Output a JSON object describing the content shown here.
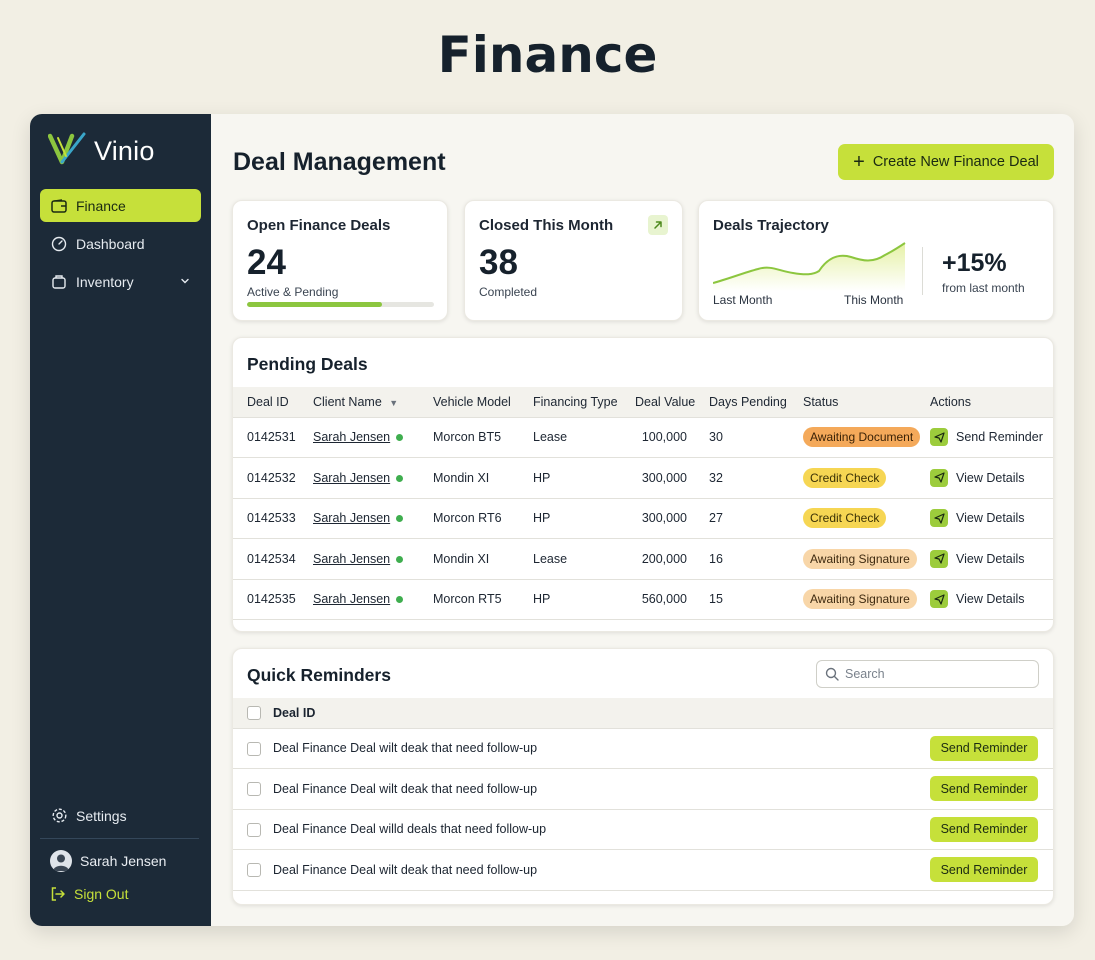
{
  "page": {
    "heading": "Finance"
  },
  "sidebar": {
    "brand": "Vinio",
    "nav": [
      {
        "label": "Finance",
        "icon": "wallet-icon",
        "active": true
      },
      {
        "label": "Dashboard",
        "icon": "gauge-icon"
      },
      {
        "label": "Inventory",
        "icon": "box-icon",
        "expandable": true
      }
    ],
    "settings_label": "Settings",
    "user_name": "Sarah Jensen",
    "signout_label": "Sign Out"
  },
  "header": {
    "title": "Deal Management",
    "cta_label": "Create New Finance Deal"
  },
  "stats": {
    "open": {
      "title": "Open Finance Deals",
      "value": "24",
      "sub": "Active & Pending",
      "progress": 0.72
    },
    "closed": {
      "title": "Closed This Month",
      "value": "38",
      "sub": "Completed"
    },
    "trajectory": {
      "title": "Deals Trajectory",
      "from_label": "Last Month",
      "to_label": "This Month",
      "change": "+15%",
      "change_sub": "from last month"
    }
  },
  "pending": {
    "title": "Pending Deals",
    "columns": [
      "Deal ID",
      "Client Name",
      "Vehicle Model",
      "Financing Type",
      "Deal Value",
      "Days Pending",
      "Status",
      "Actions"
    ],
    "rows": [
      {
        "id": "0142531",
        "client": "Sarah Jensen",
        "vehicle": "Morcon BT5",
        "type": "Lease",
        "value": "100,000",
        "days": "30",
        "status": "Awaiting Document",
        "status_color": "#f4a95a",
        "action": "Send Reminder"
      },
      {
        "id": "0142532",
        "client": "Sarah Jensen",
        "vehicle": "Mondin XI",
        "type": "HP",
        "value": "300,000",
        "days": "32",
        "status": "Credit Check",
        "status_color": "#f6d653",
        "action": "View Details"
      },
      {
        "id": "0142533",
        "client": "Sarah Jensen",
        "vehicle": "Morcon RT6",
        "type": "HP",
        "value": "300,000",
        "days": "27",
        "status": "Credit Check",
        "status_color": "#f6d653",
        "action": "View Details"
      },
      {
        "id": "0142534",
        "client": "Sarah Jensen",
        "vehicle": "Mondin XI",
        "type": "Lease",
        "value": "200,000",
        "days": "16",
        "status": "Awaiting Signature",
        "status_color": "#f8d6a8",
        "action": "View Details"
      },
      {
        "id": "0142535",
        "client": "Sarah Jensen",
        "vehicle": "Morcon RT5",
        "type": "HP",
        "value": "560,000",
        "days": "15",
        "status": "Awaiting Signature",
        "status_color": "#f8d6a8",
        "action": "View Details"
      }
    ]
  },
  "reminders": {
    "title": "Quick Reminders",
    "search_placeholder": "Search",
    "column": "Deal ID",
    "button_label": "Send Reminder",
    "items": [
      "Deal Finance Deal wilt deak that need follow-up",
      "Deal Finance Deal wilt deak that need follow-up",
      "Deal Finance Deal willd deals that need follow-up",
      "Deal Finance Deal wilt deak that need follow-up"
    ]
  },
  "colors": {
    "accent": "#c6e03a",
    "sidebar": "#1c2a38",
    "online": "#3fae4f"
  }
}
